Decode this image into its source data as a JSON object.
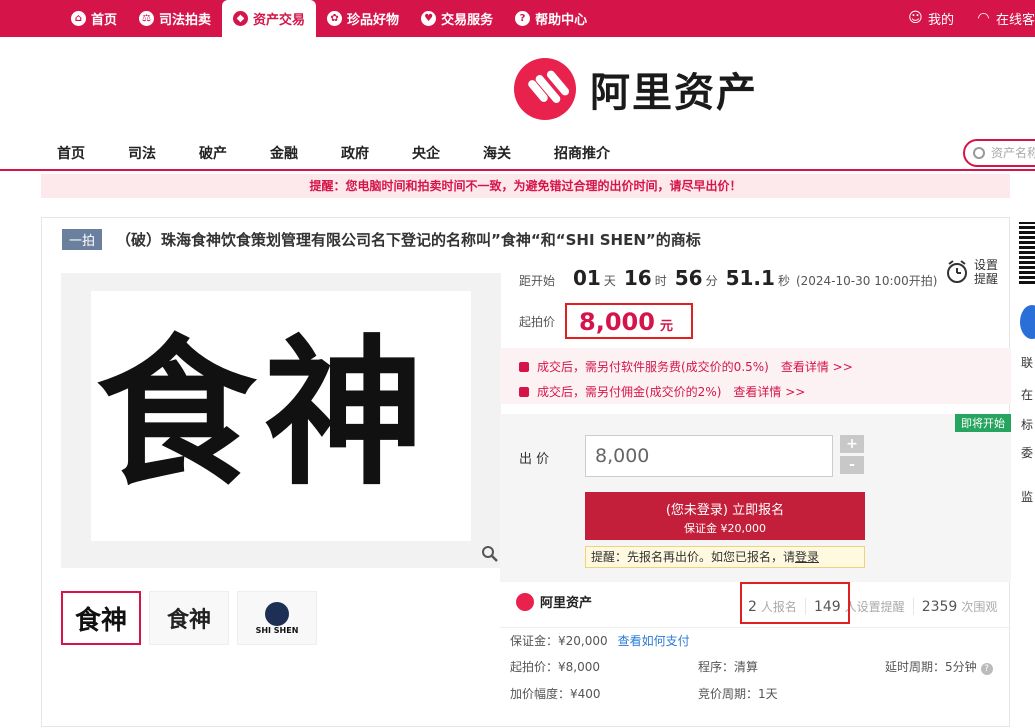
{
  "top_nav": {
    "items": [
      {
        "label": "首页",
        "icon": "home-icon"
      },
      {
        "label": "司法拍卖",
        "icon": "court-icon"
      },
      {
        "label": "资产交易",
        "icon": "asset-icon"
      },
      {
        "label": "珍品好物",
        "icon": "gem-icon"
      },
      {
        "label": "交易服务",
        "icon": "heart-icon"
      },
      {
        "label": "帮助中心",
        "icon": "help-icon"
      }
    ],
    "active": "资产交易",
    "right": [
      {
        "label": "我的",
        "icon": "user-icon"
      },
      {
        "label": "在线客",
        "icon": "headset-icon"
      }
    ]
  },
  "logo": {
    "text": "阿里资产"
  },
  "category_nav": {
    "items": [
      "首页",
      "司法",
      "破产",
      "金融",
      "政府",
      "央企",
      "海关",
      "招商推介"
    ],
    "search_placeholder": "资产名称"
  },
  "notice": "提醒：您电脑时间和拍卖时间不一致，为避免错过合理的出价时间，请尽早出价！",
  "lot": {
    "tag": "一拍",
    "title": "（破）珠海食神饮食策划管理有限公司名下登记的名称叫”食神“和“SHI SHEN”的商标"
  },
  "countdown": {
    "label": "距开始",
    "days": "01",
    "days_unit": "天",
    "hours": "16",
    "hours_unit": "时",
    "minutes": "56",
    "minutes_unit": "分",
    "seconds": "51.1",
    "seconds_unit": "秒",
    "note": "(2024-10-30 10:00开拍)"
  },
  "reminder": {
    "label": "设置提醒"
  },
  "price": {
    "label": "起拍价",
    "value": "8,000",
    "unit": "元"
  },
  "fees": [
    {
      "text": "成交后，需另付软件服务费(成交价的0.5%)",
      "link": "查看详情 >>"
    },
    {
      "text": "成交后，需另付佣金(成交价的2%)",
      "link": "查看详情 >>"
    }
  ],
  "bid": {
    "status_badge": "即将开始",
    "label": "出 价",
    "value": "8,000",
    "plus": "+",
    "minus": "-",
    "register_line1": "(您未登录) 立即报名",
    "register_line2": "保证金 ¥20,000",
    "tip_prefix": "提醒：先报名再出价。如您已报名，请",
    "tip_link": "登录"
  },
  "org": {
    "name": "阿里资产"
  },
  "stats": [
    {
      "value": "2",
      "label": "人报名"
    },
    {
      "value": "149",
      "label": "人设置提醒"
    },
    {
      "value": "2359",
      "label": "次围观"
    }
  ],
  "details": {
    "deposit": "保证金：¥20,000",
    "deposit_link": "查看如何支付",
    "start_price": "起拍价：¥8,000",
    "procedure": "程序：清算",
    "delay": "延时周期：5分钟",
    "increment": "加价幅度：¥400",
    "bid_cycle": "竞价周期：1天"
  },
  "gallery": {
    "main_text": "食神",
    "thumbs": [
      "食神",
      "食神",
      "SHI SHEN"
    ]
  },
  "sidebar": {
    "lines": [
      "联",
      "在",
      "标",
      "委",
      "监"
    ]
  },
  "colors": {
    "brand": "#d5154a",
    "button": "#c41f3a",
    "badge_green": "#25a55f",
    "link": "#2a7ad6"
  }
}
